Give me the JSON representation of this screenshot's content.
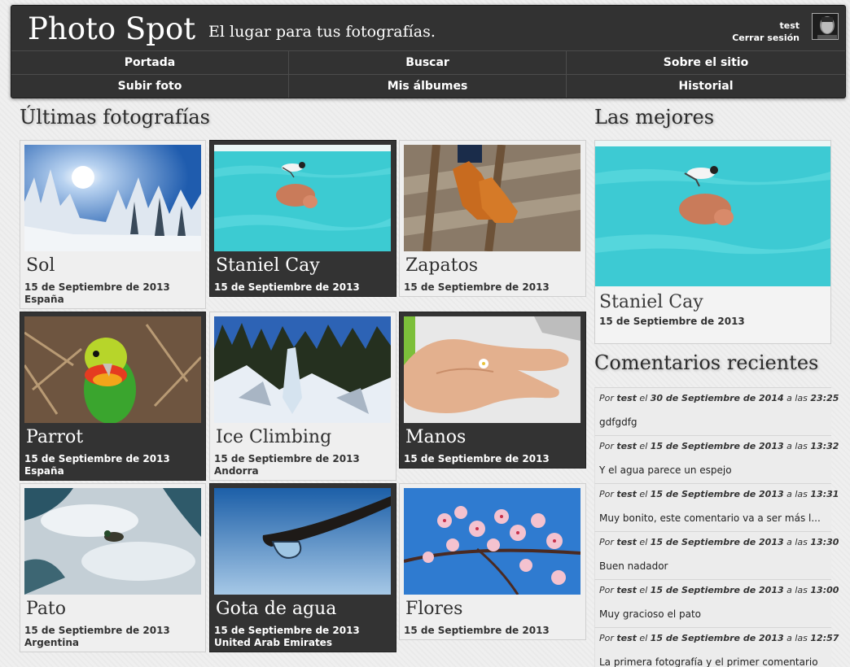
{
  "header": {
    "brand": "Photo Spot",
    "tagline": "El lugar para tus fotografías.",
    "user_name": "test",
    "logout": "Cerrar sesión"
  },
  "nav": {
    "portada": "Portada",
    "buscar": "Buscar",
    "sobre": "Sobre el sitio",
    "subir": "Subir foto",
    "albumes": "Mis álbumes",
    "historial": "Historial"
  },
  "latest": {
    "heading": "Últimas fotografías",
    "photos": [
      {
        "title": "Sol",
        "date": "15 de Septiembre de 2013",
        "place": "España"
      },
      {
        "title": "Staniel Cay",
        "date": "15 de Septiembre de 2013",
        "place": ""
      },
      {
        "title": "Zapatos",
        "date": "15 de Septiembre de 2013",
        "place": ""
      },
      {
        "title": "Parrot",
        "date": "15 de Septiembre de 2013",
        "place": "España"
      },
      {
        "title": "Ice Climbing",
        "date": "15 de Septiembre de 2013",
        "place": "Andorra"
      },
      {
        "title": "Manos",
        "date": "15 de Septiembre de 2013",
        "place": ""
      },
      {
        "title": "Pato",
        "date": "15 de Septiembre de 2013",
        "place": "Argentina"
      },
      {
        "title": "Gota de agua",
        "date": "15 de Septiembre de 2013",
        "place": "United Arab Emirates"
      },
      {
        "title": "Flores",
        "date": "15 de Septiembre de 2013",
        "place": ""
      }
    ]
  },
  "best": {
    "heading": "Las mejores",
    "title": "Staniel Cay",
    "date": "15 de Septiembre de 2013"
  },
  "comments": {
    "heading": "Comentarios recientes",
    "by": "Por",
    "on": "el",
    "at": "a las",
    "items": [
      {
        "user": "test",
        "date": "30 de Septiembre de 2014",
        "time": "23:25",
        "text": "gdfgdfg"
      },
      {
        "user": "test",
        "date": "15 de Septiembre de 2013",
        "time": "13:32",
        "text": "Y el agua parece un espejo"
      },
      {
        "user": "test",
        "date": "15 de Septiembre de 2013",
        "time": "13:31",
        "text": "Muy bonito, este comentario va a ser más l..."
      },
      {
        "user": "test",
        "date": "15 de Septiembre de 2013",
        "time": "13:30",
        "text": "Buen nadador"
      },
      {
        "user": "test",
        "date": "15 de Septiembre de 2013",
        "time": "13:00",
        "text": "Muy gracioso el pato"
      },
      {
        "user": "test",
        "date": "15 de Septiembre de 2013",
        "time": "12:57",
        "text": "La primera fotografía y el primer comentario"
      }
    ]
  }
}
